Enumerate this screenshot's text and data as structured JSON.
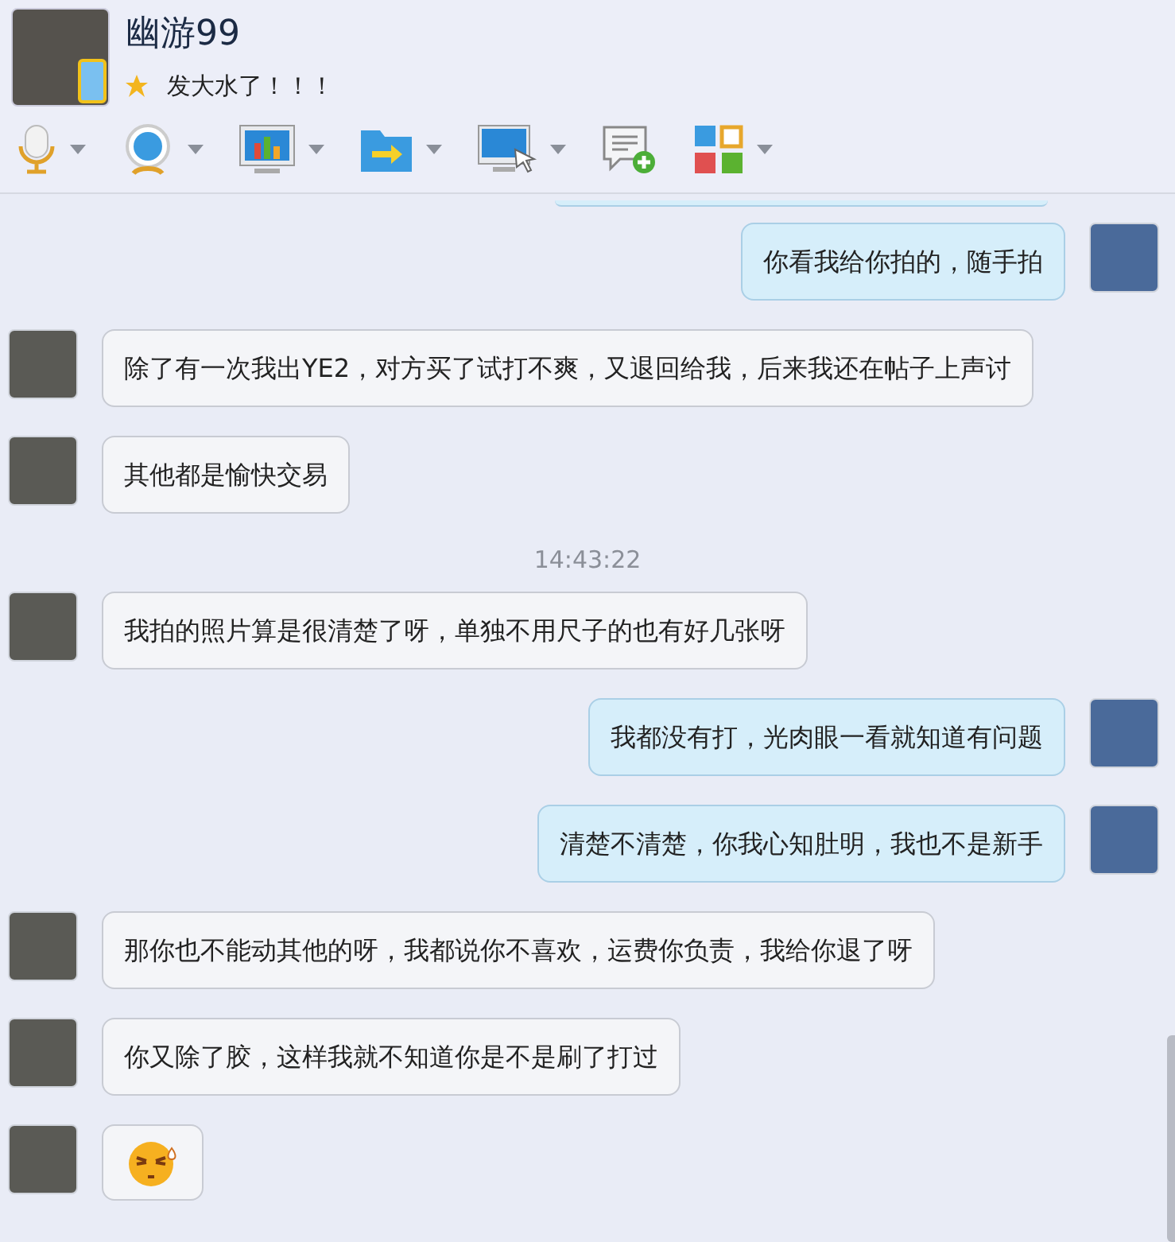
{
  "contact": {
    "name": "幽游99",
    "status": "发大水了！！！"
  },
  "toolbar": [
    {
      "kind": "mic",
      "dropdown": true
    },
    {
      "kind": "camera",
      "dropdown": true
    },
    {
      "kind": "screen-chart",
      "dropdown": true
    },
    {
      "kind": "folder",
      "dropdown": true
    },
    {
      "kind": "remote",
      "dropdown": true
    },
    {
      "kind": "chat-add",
      "dropdown": false
    },
    {
      "kind": "apps",
      "dropdown": true
    }
  ],
  "messages": [
    {
      "kind": "outgoing-partial"
    },
    {
      "kind": "outgoing",
      "text": "你看我给你拍的，随手拍"
    },
    {
      "kind": "incoming",
      "text": "除了有一次我出YE2，对方买了试打不爽，又退回给我，后来我还在帖子上声讨"
    },
    {
      "kind": "incoming",
      "text": "其他都是愉快交易"
    },
    {
      "kind": "time",
      "text": "14:43:22"
    },
    {
      "kind": "incoming",
      "text": "我拍的照片算是很清楚了呀，单独不用尺子的也有好几张呀"
    },
    {
      "kind": "outgoing",
      "text": "我都没有打，光肉眼一看就知道有问题"
    },
    {
      "kind": "outgoing",
      "text": "清楚不清楚，你我心知肚明，我也不是新手"
    },
    {
      "kind": "incoming",
      "text": "那你也不能动其他的呀，我都说你不喜欢，运费你负责，我给你退了呀"
    },
    {
      "kind": "incoming",
      "text": "你又除了胶，这样我就不知道你是不是刷了打过"
    },
    {
      "kind": "incoming-emoji"
    }
  ]
}
